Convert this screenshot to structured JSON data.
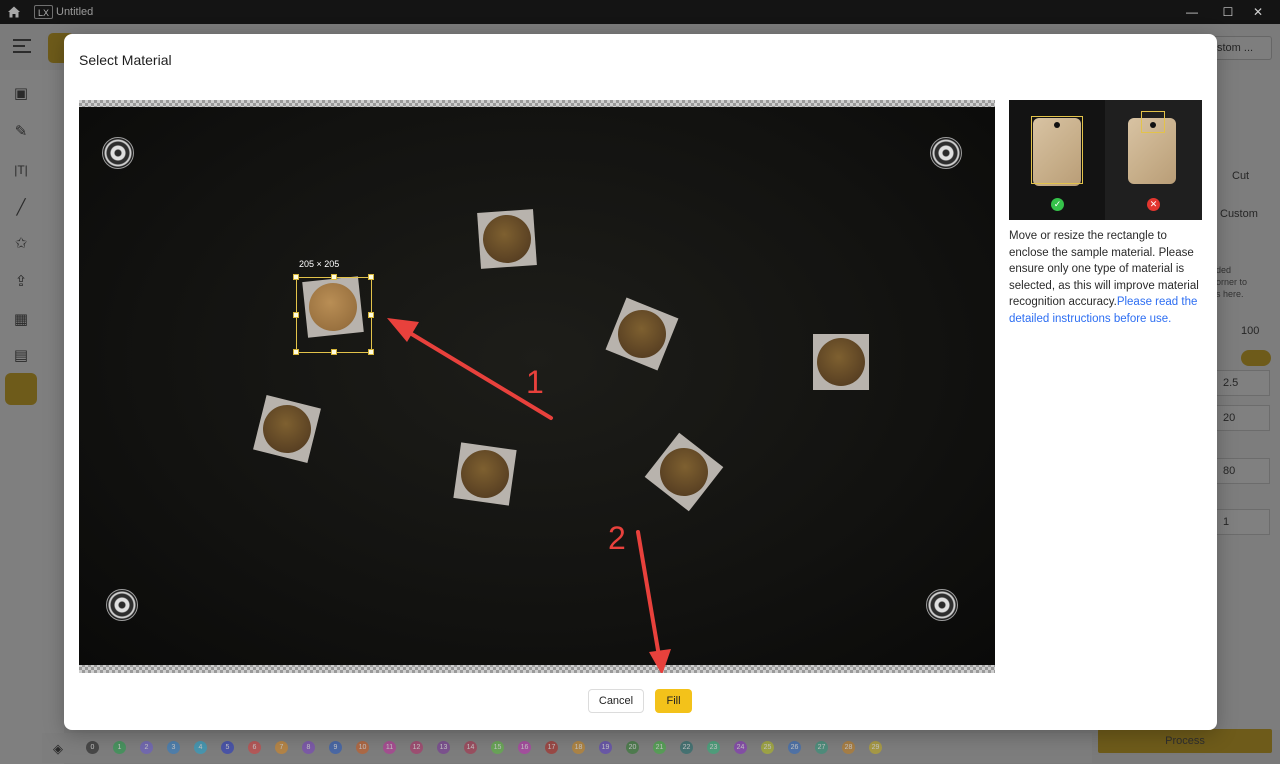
{
  "window": {
    "logo_text": "LX",
    "document_title": "Untitled",
    "minimize": "—",
    "maximize": "☐",
    "close": "✕"
  },
  "right_panel": {
    "custom_dropdown": "stom ...",
    "cut_label": "Cut",
    "custom_label": "Custom",
    "hint_partial": [
      "ded",
      "orner to",
      "s here."
    ],
    "value_100": "100",
    "field_values": [
      "2.5",
      "20",
      "80",
      "1"
    ],
    "process_label": "Process"
  },
  "bottom_bar": {
    "layers": [
      {
        "n": "0",
        "color": "#1b1b1b"
      },
      {
        "n": "1",
        "color": "#1fa347"
      },
      {
        "n": "2",
        "color": "#6a5ad6"
      },
      {
        "n": "3",
        "color": "#2a7fd0"
      },
      {
        "n": "4",
        "color": "#1eaad6"
      },
      {
        "n": "5",
        "color": "#2233c9"
      },
      {
        "n": "6",
        "color": "#e03a3a"
      },
      {
        "n": "7",
        "color": "#e08a1c"
      },
      {
        "n": "8",
        "color": "#7b3fc8"
      },
      {
        "n": "9",
        "color": "#2258c4"
      },
      {
        "n": "10",
        "color": "#d45a1a"
      },
      {
        "n": "11",
        "color": "#c42aa0"
      },
      {
        "n": "12",
        "color": "#b82a6a"
      },
      {
        "n": "13",
        "color": "#7a2f9c"
      },
      {
        "n": "14",
        "color": "#b02a4a"
      },
      {
        "n": "15",
        "color": "#5ac23a"
      },
      {
        "n": "16",
        "color": "#c22ab8"
      },
      {
        "n": "17",
        "color": "#b0201a"
      },
      {
        "n": "18",
        "color": "#d48a1a"
      },
      {
        "n": "19",
        "color": "#5a3ac8"
      },
      {
        "n": "20",
        "color": "#2a7a2a"
      },
      {
        "n": "21",
        "color": "#3ab83a"
      },
      {
        "n": "22",
        "color": "#1a6a6a"
      },
      {
        "n": "23",
        "color": "#2ab87a"
      },
      {
        "n": "24",
        "color": "#8a2ac8"
      },
      {
        "n": "25",
        "color": "#b8c21a"
      },
      {
        "n": "26",
        "color": "#2a6ac8"
      },
      {
        "n": "27",
        "color": "#2a9a7a"
      },
      {
        "n": "28",
        "color": "#c8801a"
      },
      {
        "n": "29",
        "color": "#c8b01a"
      }
    ]
  },
  "modal": {
    "title": "Select Material",
    "selection_size": "205 × 205",
    "zoom": {
      "reset_icon": "⟳",
      "zoom_out_icon": "⊖",
      "zoom_in_icon": "⊕"
    },
    "annotations": [
      "1",
      "2"
    ],
    "help_text": "Move or resize the rectangle to enclose the sample material. Please ensure only one type of material is selected, as this will improve material recognition accuracy.",
    "help_link": "Please read the detailed instructions before use.",
    "cancel_label": "Cancel",
    "fill_label": "Fill",
    "accent_color": "#f3c21a",
    "link_color": "#2d6ef2"
  }
}
